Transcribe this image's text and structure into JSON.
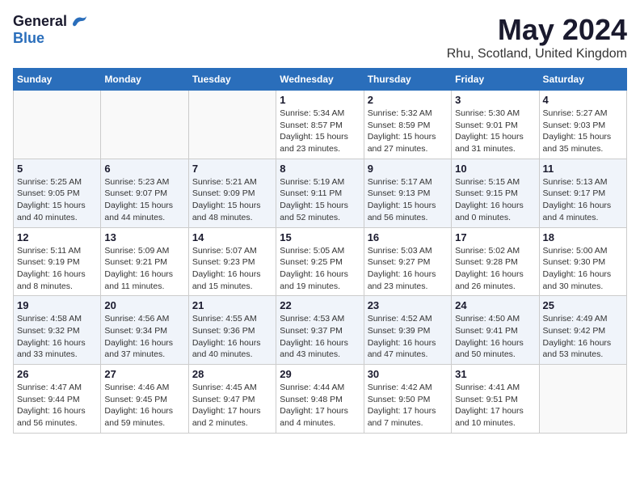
{
  "header": {
    "logo_general": "General",
    "logo_blue": "Blue",
    "month_year": "May 2024",
    "location": "Rhu, Scotland, United Kingdom"
  },
  "days_of_week": [
    "Sunday",
    "Monday",
    "Tuesday",
    "Wednesday",
    "Thursday",
    "Friday",
    "Saturday"
  ],
  "weeks": [
    [
      {
        "day": "",
        "info": ""
      },
      {
        "day": "",
        "info": ""
      },
      {
        "day": "",
        "info": ""
      },
      {
        "day": "1",
        "info": "Sunrise: 5:34 AM\nSunset: 8:57 PM\nDaylight: 15 hours\nand 23 minutes."
      },
      {
        "day": "2",
        "info": "Sunrise: 5:32 AM\nSunset: 8:59 PM\nDaylight: 15 hours\nand 27 minutes."
      },
      {
        "day": "3",
        "info": "Sunrise: 5:30 AM\nSunset: 9:01 PM\nDaylight: 15 hours\nand 31 minutes."
      },
      {
        "day": "4",
        "info": "Sunrise: 5:27 AM\nSunset: 9:03 PM\nDaylight: 15 hours\nand 35 minutes."
      }
    ],
    [
      {
        "day": "5",
        "info": "Sunrise: 5:25 AM\nSunset: 9:05 PM\nDaylight: 15 hours\nand 40 minutes."
      },
      {
        "day": "6",
        "info": "Sunrise: 5:23 AM\nSunset: 9:07 PM\nDaylight: 15 hours\nand 44 minutes."
      },
      {
        "day": "7",
        "info": "Sunrise: 5:21 AM\nSunset: 9:09 PM\nDaylight: 15 hours\nand 48 minutes."
      },
      {
        "day": "8",
        "info": "Sunrise: 5:19 AM\nSunset: 9:11 PM\nDaylight: 15 hours\nand 52 minutes."
      },
      {
        "day": "9",
        "info": "Sunrise: 5:17 AM\nSunset: 9:13 PM\nDaylight: 15 hours\nand 56 minutes."
      },
      {
        "day": "10",
        "info": "Sunrise: 5:15 AM\nSunset: 9:15 PM\nDaylight: 16 hours\nand 0 minutes."
      },
      {
        "day": "11",
        "info": "Sunrise: 5:13 AM\nSunset: 9:17 PM\nDaylight: 16 hours\nand 4 minutes."
      }
    ],
    [
      {
        "day": "12",
        "info": "Sunrise: 5:11 AM\nSunset: 9:19 PM\nDaylight: 16 hours\nand 8 minutes."
      },
      {
        "day": "13",
        "info": "Sunrise: 5:09 AM\nSunset: 9:21 PM\nDaylight: 16 hours\nand 11 minutes."
      },
      {
        "day": "14",
        "info": "Sunrise: 5:07 AM\nSunset: 9:23 PM\nDaylight: 16 hours\nand 15 minutes."
      },
      {
        "day": "15",
        "info": "Sunrise: 5:05 AM\nSunset: 9:25 PM\nDaylight: 16 hours\nand 19 minutes."
      },
      {
        "day": "16",
        "info": "Sunrise: 5:03 AM\nSunset: 9:27 PM\nDaylight: 16 hours\nand 23 minutes."
      },
      {
        "day": "17",
        "info": "Sunrise: 5:02 AM\nSunset: 9:28 PM\nDaylight: 16 hours\nand 26 minutes."
      },
      {
        "day": "18",
        "info": "Sunrise: 5:00 AM\nSunset: 9:30 PM\nDaylight: 16 hours\nand 30 minutes."
      }
    ],
    [
      {
        "day": "19",
        "info": "Sunrise: 4:58 AM\nSunset: 9:32 PM\nDaylight: 16 hours\nand 33 minutes."
      },
      {
        "day": "20",
        "info": "Sunrise: 4:56 AM\nSunset: 9:34 PM\nDaylight: 16 hours\nand 37 minutes."
      },
      {
        "day": "21",
        "info": "Sunrise: 4:55 AM\nSunset: 9:36 PM\nDaylight: 16 hours\nand 40 minutes."
      },
      {
        "day": "22",
        "info": "Sunrise: 4:53 AM\nSunset: 9:37 PM\nDaylight: 16 hours\nand 43 minutes."
      },
      {
        "day": "23",
        "info": "Sunrise: 4:52 AM\nSunset: 9:39 PM\nDaylight: 16 hours\nand 47 minutes."
      },
      {
        "day": "24",
        "info": "Sunrise: 4:50 AM\nSunset: 9:41 PM\nDaylight: 16 hours\nand 50 minutes."
      },
      {
        "day": "25",
        "info": "Sunrise: 4:49 AM\nSunset: 9:42 PM\nDaylight: 16 hours\nand 53 minutes."
      }
    ],
    [
      {
        "day": "26",
        "info": "Sunrise: 4:47 AM\nSunset: 9:44 PM\nDaylight: 16 hours\nand 56 minutes."
      },
      {
        "day": "27",
        "info": "Sunrise: 4:46 AM\nSunset: 9:45 PM\nDaylight: 16 hours\nand 59 minutes."
      },
      {
        "day": "28",
        "info": "Sunrise: 4:45 AM\nSunset: 9:47 PM\nDaylight: 17 hours\nand 2 minutes."
      },
      {
        "day": "29",
        "info": "Sunrise: 4:44 AM\nSunset: 9:48 PM\nDaylight: 17 hours\nand 4 minutes."
      },
      {
        "day": "30",
        "info": "Sunrise: 4:42 AM\nSunset: 9:50 PM\nDaylight: 17 hours\nand 7 minutes."
      },
      {
        "day": "31",
        "info": "Sunrise: 4:41 AM\nSunset: 9:51 PM\nDaylight: 17 hours\nand 10 minutes."
      },
      {
        "day": "",
        "info": ""
      }
    ]
  ]
}
